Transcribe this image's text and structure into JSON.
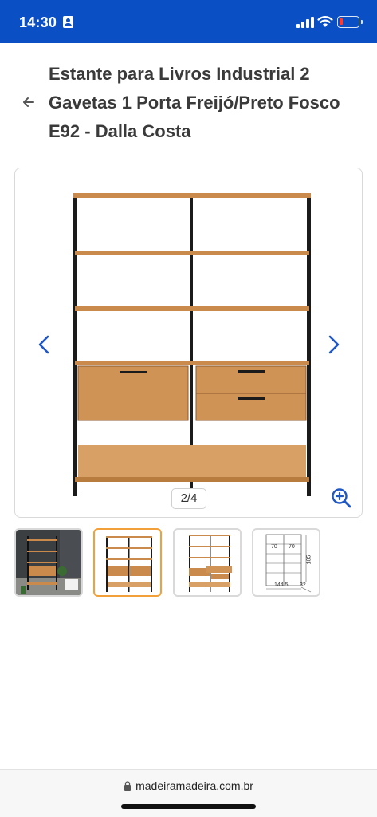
{
  "status_bar": {
    "time": "14:30",
    "background": "#0a4fc4",
    "battery_color": "#ff3b30",
    "icons": [
      "person-icon",
      "signal-icon",
      "wifi-icon",
      "battery-icon"
    ]
  },
  "header": {
    "back_icon": "arrow-left-icon",
    "title": "Estante para Livros Industrial 2 Gavetas 1 Porta Freijó/Preto Fosco E92 - Dalla Costa"
  },
  "gallery": {
    "counter": "2/4",
    "prev_icon": "chevron-left-icon",
    "next_icon": "chevron-right-icon",
    "zoom_icon": "zoom-in-icon",
    "accent": "#0a4fc4",
    "wood_color": "#c98a4b",
    "metal_color": "#1b1b1b"
  },
  "thumbnails": {
    "active_border": "#f2a13a",
    "items": [
      {
        "name": "thumb-room-scene"
      },
      {
        "name": "thumb-front-view"
      },
      {
        "name": "thumb-open-view"
      },
      {
        "name": "thumb-dimensions",
        "dims": {
          "h1": "70",
          "h2": "70",
          "height": "185",
          "width": "144.5",
          "depth": "32"
        }
      }
    ]
  },
  "browser": {
    "url": "madeiramadeira.com.br",
    "lock_icon": "lock-icon"
  }
}
